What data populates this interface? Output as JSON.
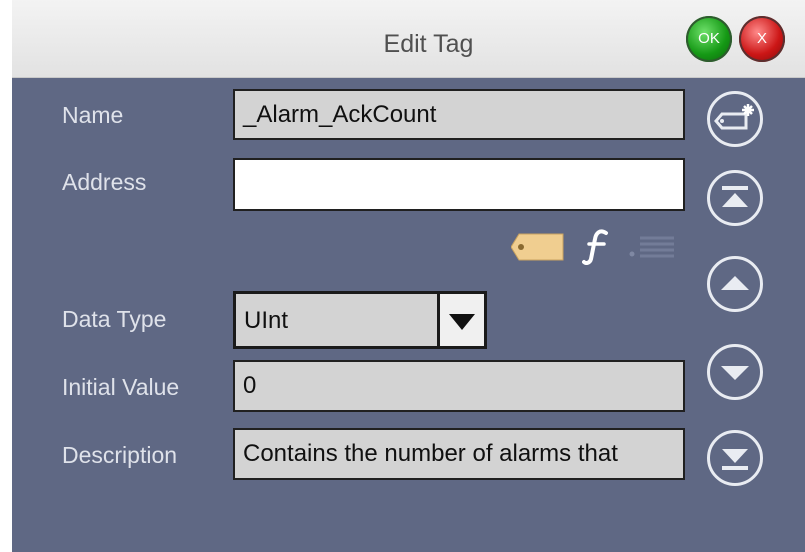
{
  "dialog": {
    "title": "Edit Tag",
    "ok_label": "OK",
    "cancel_label": "X"
  },
  "fields": {
    "name_label": "Name",
    "name_value": "_Alarm_AckCount",
    "address_label": "Address",
    "address_value": "",
    "data_type_label": "Data Type",
    "data_type_value": "UInt",
    "initial_value_label": "Initial Value",
    "initial_value": "0",
    "description_label": "Description",
    "description_value": "Contains the number of alarms that"
  },
  "icons": {
    "address_tools": [
      "tag-icon",
      "function-icon",
      "list-icon"
    ],
    "side_buttons": [
      "new-tag-icon",
      "first-record-icon",
      "previous-record-icon",
      "next-record-icon",
      "last-record-icon"
    ]
  },
  "colors": {
    "panel": "#5f6884",
    "ok": "#159915",
    "cancel": "#cc1616"
  }
}
